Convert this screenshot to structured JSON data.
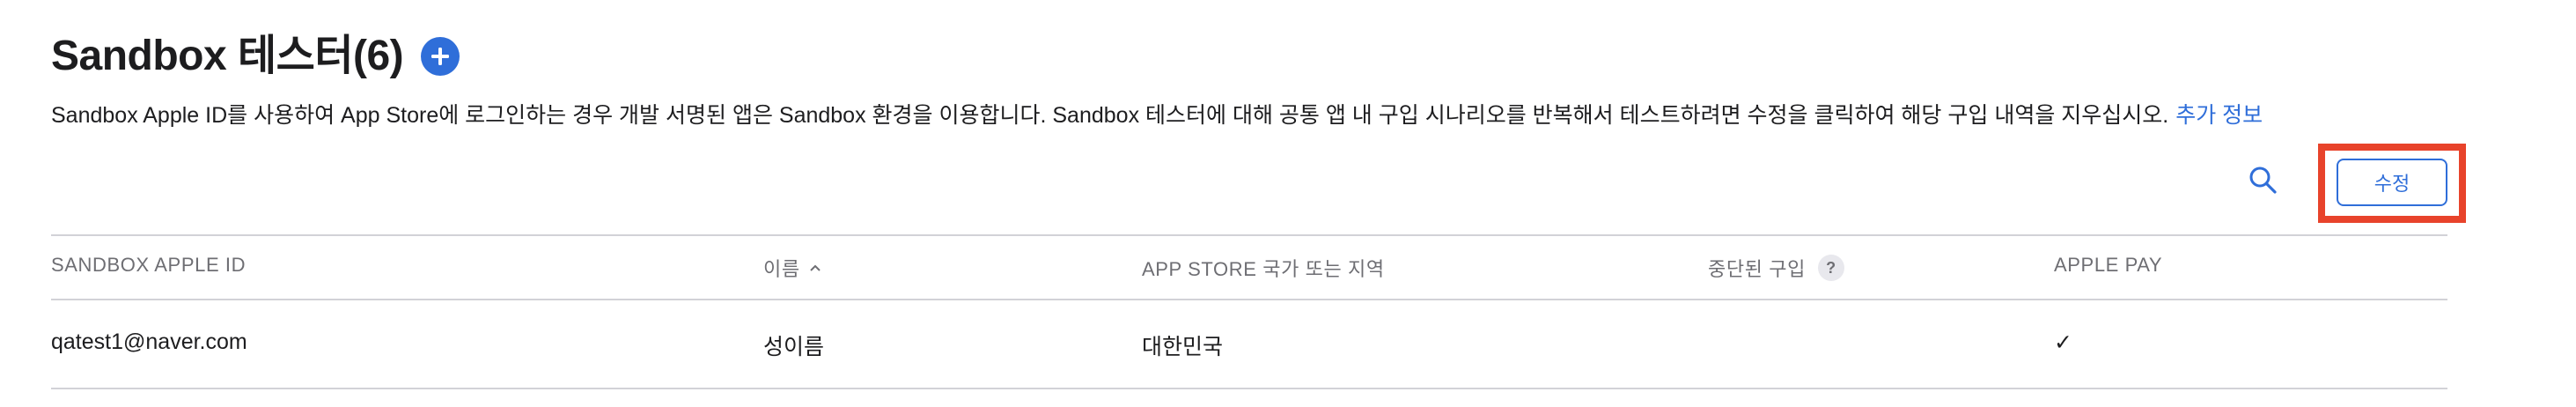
{
  "header": {
    "title": "Sandbox 테스터(6)",
    "add_icon": "plus-circle-icon"
  },
  "description": {
    "text": "Sandbox Apple ID를 사용하여 App Store에 로그인하는 경우 개발 서명된 앱은 Sandbox 환경을 이용합니다. Sandbox 테스터에 대해 공통 앱 내 구입 시나리오를 반복해서 테스트하려면 수정을 클릭하여 해당 구입 내역을 지우십시오.",
    "link_label": "추가 정보"
  },
  "toolbar": {
    "search_icon": "search-icon",
    "edit_label": "수정"
  },
  "table": {
    "columns": {
      "apple_id": "SANDBOX APPLE ID",
      "name": "이름",
      "region": "APP STORE 국가 또는 지역",
      "interrupted": "중단된 구입",
      "apple_pay": "APPLE PAY"
    },
    "help_glyph": "?",
    "rows": [
      {
        "apple_id": "qatest1@naver.com",
        "name": "성이름",
        "region": "대한민국",
        "interrupted": "",
        "apple_pay": "✓"
      }
    ]
  },
  "colors": {
    "accent": "#2f6ed9",
    "highlight": "#e8432b",
    "divider": "#d2d2d7",
    "muted_text": "#6e6e73"
  }
}
